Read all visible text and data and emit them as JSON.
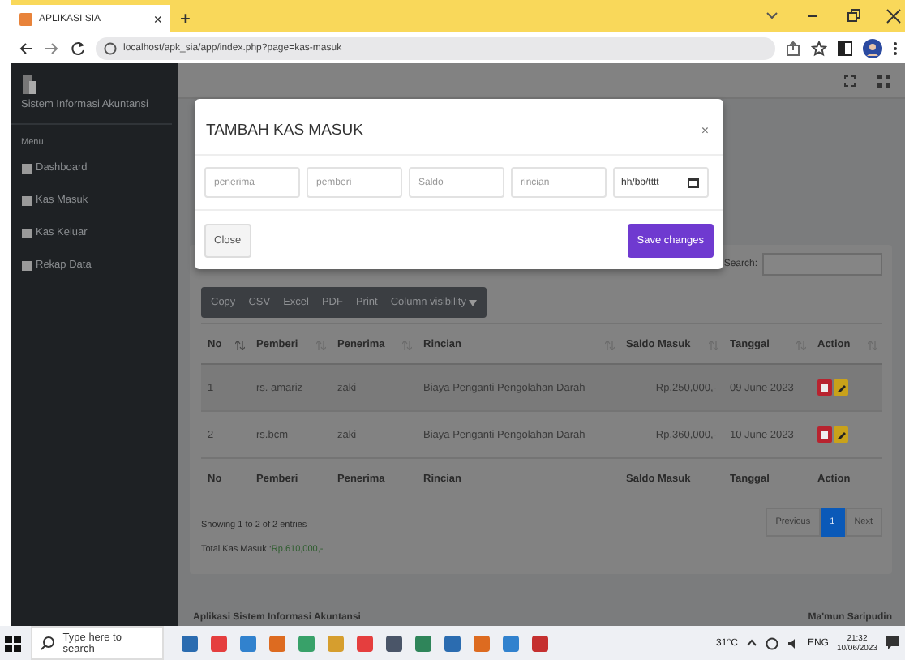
{
  "browser": {
    "tab_title": "APLIKASI SIA",
    "tab_close": "×",
    "new_tab": "+",
    "url": "localhost/apk_sia/app/index.php?page=kas-masuk"
  },
  "sidebar": {
    "brand": "Sistem Informasi Akuntansi",
    "menu_label": "Menu",
    "items": [
      {
        "label": "Dashboard"
      },
      {
        "label": "Kas Masuk"
      },
      {
        "label": "Kas Keluar"
      },
      {
        "label": "Rekap Data"
      }
    ]
  },
  "modal": {
    "title": "TAMBAH KAS MASUK",
    "close": "×",
    "fields": [
      {
        "placeholder": "penerima",
        "kind": "text"
      },
      {
        "placeholder": "pemberi",
        "kind": "text"
      },
      {
        "placeholder": "Saldo",
        "kind": "text"
      },
      {
        "placeholder": "rincian",
        "kind": "text"
      },
      {
        "placeholder": "hh/bb/tttt",
        "kind": "date"
      }
    ],
    "buttons": [
      {
        "label": "Close",
        "kind": "secondary"
      },
      {
        "label": "Save changes",
        "kind": "primary"
      }
    ]
  },
  "search_label": "Search:",
  "export_buttons": [
    "Copy",
    "CSV",
    "Excel",
    "PDF",
    "Print",
    "Column visibility"
  ],
  "table": {
    "columns": [
      "No",
      "Pemberi",
      "Penerima",
      "Rincian",
      "Saldo Masuk",
      "Tanggal",
      "Action"
    ],
    "rows": [
      [
        "1",
        "rs. amariz",
        "zaki",
        "Biaya Penganti Pengolahan Darah",
        "Rp.250,000,-",
        "09 June 2023"
      ],
      [
        "2",
        "rs.bcm",
        "zaki",
        "Biaya Penganti Pengolahan Darah",
        "Rp.360,000,-",
        "10 June 2023"
      ]
    ],
    "footer": [
      "No",
      "Pemberi",
      "Penerima",
      "Rincian",
      "Saldo Masuk",
      "Tanggal",
      "Action"
    ]
  },
  "info": "Showing 1 to 2 of 2 entries",
  "total_label": "Total Kas Masuk :",
  "total_value": "Rp.610,000,-",
  "pagination": [
    {
      "label": "Previous",
      "selected": false
    },
    {
      "label": "1",
      "selected": true
    },
    {
      "label": "Next",
      "selected": false
    }
  ],
  "footer": {
    "left": "Aplikasi Sistem Informasi Akuntansi",
    "right": "Ma'mun Saripudin"
  },
  "taskbar": {
    "search_placeholder": "Type here to search",
    "weather": "31°C",
    "language": "ENG",
    "time": "21:32",
    "date": "10/06/2023"
  }
}
